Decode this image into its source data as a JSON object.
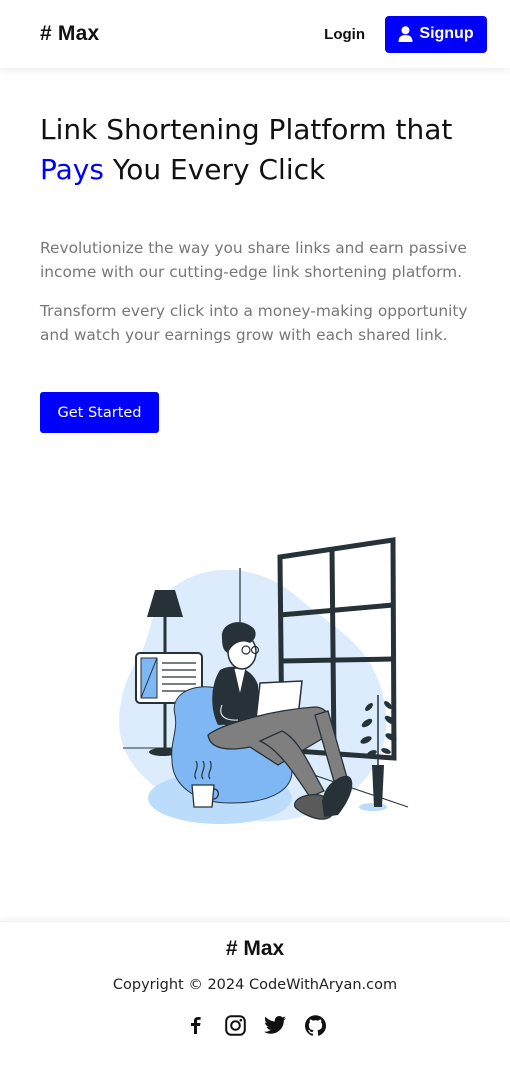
{
  "navbar": {
    "brand": "# Max",
    "login_label": "Login",
    "signup_label": "Signup"
  },
  "hero": {
    "title_line1": "Link Shortening Platform that",
    "title_accent": "Pays",
    "title_rest": " You Every Click",
    "paragraph1": "Revolutionize the way you share links and earn passive income with our cutting-edge link shortening platform.",
    "paragraph2": "Transform every click into a money-making opportunity and watch your earnings grow with each shared link.",
    "cta_label": "Get Started"
  },
  "illustration": {
    "icon": "person-with-laptop-illustration"
  },
  "footer": {
    "brand": "# Max",
    "copyright": "Copyright © 2024 CodeWithAryan.com",
    "socials": [
      "facebook-icon",
      "instagram-icon",
      "twitter-icon",
      "github-icon"
    ]
  },
  "colors": {
    "accent": "#0000ff",
    "muted_text": "#777777",
    "illustration_blue": "#dcecfd",
    "illustration_dark": "#263238"
  }
}
